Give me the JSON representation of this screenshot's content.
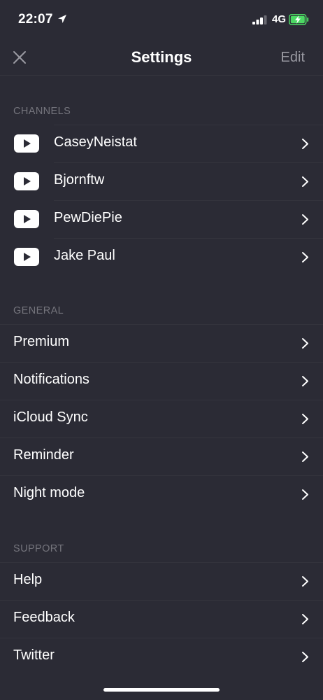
{
  "status_bar": {
    "time": "22:07",
    "network": "4G"
  },
  "nav": {
    "title": "Settings",
    "edit_label": "Edit"
  },
  "channels": {
    "header": "CHANNELS",
    "items": [
      {
        "label": "CaseyNeistat"
      },
      {
        "label": "Bjornftw"
      },
      {
        "label": "PewDiePie"
      },
      {
        "label": "Jake Paul"
      }
    ]
  },
  "general": {
    "header": "GENERAL",
    "items": [
      {
        "label": "Premium"
      },
      {
        "label": "Notifications"
      },
      {
        "label": "iCloud Sync"
      },
      {
        "label": "Reminder"
      },
      {
        "label": "Night mode"
      }
    ]
  },
  "support": {
    "header": "SUPPORT",
    "items": [
      {
        "label": "Help"
      },
      {
        "label": "Feedback"
      },
      {
        "label": "Twitter"
      }
    ]
  },
  "colors": {
    "background": "#2b2b35",
    "secondary_text": "#74747c",
    "battery": "#4cd964"
  }
}
